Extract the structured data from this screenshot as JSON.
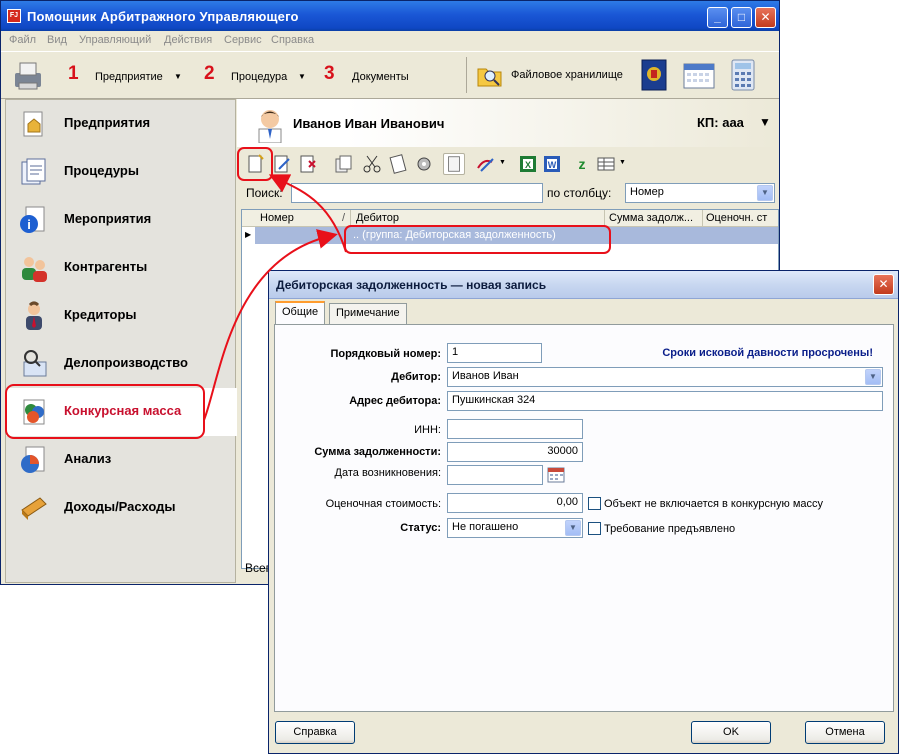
{
  "window": {
    "title": "Помощник Арбитражного Управляющего",
    "logo_text": "FJ"
  },
  "menu": [
    "Файл",
    "Вид",
    "Управляющий",
    "Действия",
    "Сервис",
    "Справка"
  ],
  "toolbar": {
    "steps": [
      {
        "number": "1",
        "label": "Предприятие"
      },
      {
        "number": "2",
        "label": "Процедура"
      },
      {
        "number": "3",
        "label": "Документы"
      }
    ],
    "file_storage": "Файловое хранилище"
  },
  "nav": {
    "items": [
      {
        "label": "Предприятия"
      },
      {
        "label": "Процедуры"
      },
      {
        "label": "Мероприятия"
      },
      {
        "label": "Контрагенты"
      },
      {
        "label": "Кредиторы"
      },
      {
        "label": "Делопроизводство"
      },
      {
        "label": "Конкурсная масса",
        "active": true
      },
      {
        "label": "Анализ"
      },
      {
        "label": "Доходы/Расходы"
      }
    ]
  },
  "user": {
    "name": "Иванов Иван Иванович",
    "kp": "КП: ааа"
  },
  "search": {
    "label": "Поиск:",
    "value": "",
    "column_label": "по столбцу:",
    "column_value": "Номер"
  },
  "grid": {
    "columns": [
      "Номер",
      "Дебитор",
      "Сумма задолж...",
      "Оценочн. ст"
    ],
    "sort_mark": "/",
    "group_row": ".. (группа: Дебиторская задолженность)",
    "status": "Всего"
  },
  "dialog": {
    "title": "Дебиторская задолженность — новая запись",
    "tabs": [
      "Общие",
      "Примечание"
    ],
    "warning": "Сроки исковой давности просрочены!",
    "fields": {
      "order_label": "Порядковый номер:",
      "order_value": "1",
      "debtor_label": "Дебитор:",
      "debtor_value": "Иванов Иван",
      "address_label": "Адрес дебитора:",
      "address_value": "Пушкинская 324",
      "inn_label": "ИНН:",
      "inn_value": "",
      "debt_label": "Сумма задолженности:",
      "debt_value": "30000",
      "date_label": "Дата возникновения:",
      "date_value": "",
      "estimate_label": "Оценочная стоимость:",
      "estimate_value": "0,00",
      "excluded_label": "Объект не включается в конкурсную массу",
      "status_label": "Статус:",
      "status_value": "Не погашено",
      "claim_label": "Требование предъявлено"
    },
    "buttons": {
      "help": "Справка",
      "ok": "OK",
      "cancel": "Отмена"
    }
  },
  "colors": {
    "title_blue": "#0f47c4",
    "annotation_red": "#e8101a",
    "selected_row": "#a8b9dc",
    "active_nav_text": "#c8102e",
    "warning_text": "#0a1e8a"
  }
}
